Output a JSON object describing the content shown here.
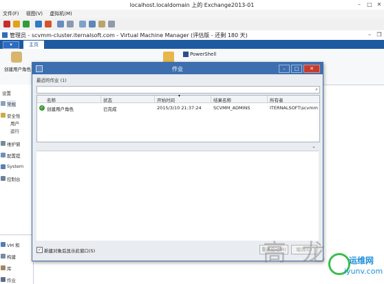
{
  "host_window": {
    "title": "localhost.localdomain 上的 Exchange2013-01",
    "menu": [
      "文件(F)",
      "视图(V)",
      "虚拟机(M)"
    ]
  },
  "vmm_window": {
    "title": "管理员 - scvmm-cluster.iternalsoft.com - Virtual Machine Manager (评估版 - 还剩 180 天)",
    "tab_home": "主页",
    "ribbon_first_label": "创建用户角色",
    "ribbon_powershell": "PowerShell"
  },
  "left_pane": {
    "section": "设置",
    "items": [
      "常规",
      "安全性",
      "用户",
      "运行",
      "维护窗",
      "配置提",
      "System",
      "控制台",
      "VM 和",
      "构建",
      "库",
      "作业"
    ]
  },
  "jobs_dialog": {
    "title": "作业",
    "recent_label": "最近的作业 (1)",
    "search_placeholder": "",
    "columns": [
      "名称",
      "状态",
      "开始时间",
      "结果名称",
      "所有者"
    ],
    "rows": [
      {
        "name": "创建用户角色",
        "status": "已完成",
        "start": "2015/3/10 21:37:24",
        "result": "SCVMM_ADMINS",
        "owner": "ITERNALSOFT\\scvmm..."
      }
    ],
    "checkbox_label": "新建对象后显示此窗口(S)",
    "checkbox_checked": true,
    "restart_button": "重新启动(R)",
    "cancel_button": "取消(C)"
  },
  "watermark": {
    "cn": "高   龙",
    "site_cn": "运维网",
    "site_url": "iyunv.com"
  }
}
